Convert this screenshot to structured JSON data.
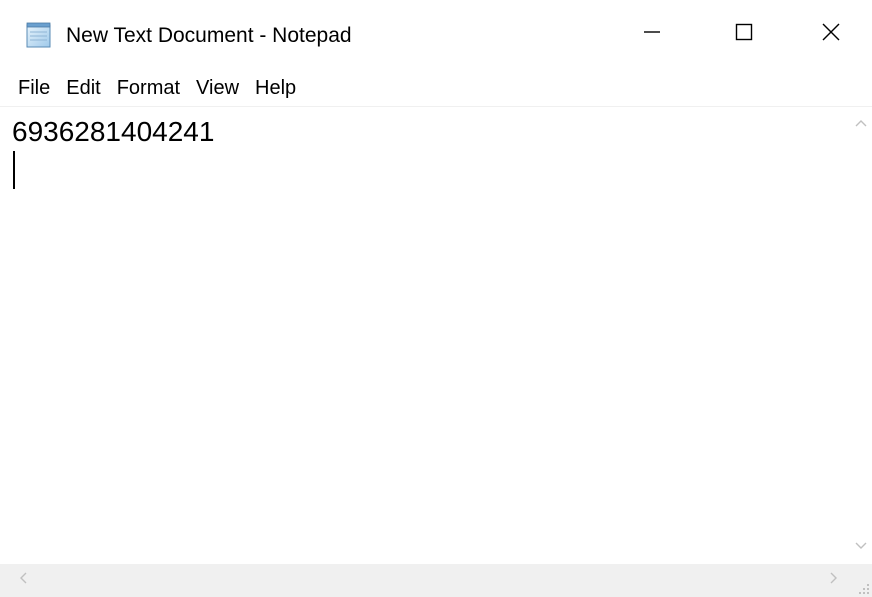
{
  "window": {
    "title": "New Text Document - Notepad"
  },
  "title_buttons": {
    "minimize_icon": "minimize-icon",
    "maximize_icon": "maximize-icon",
    "close_icon": "close-icon"
  },
  "menu": {
    "items": [
      {
        "label": "File"
      },
      {
        "label": "Edit"
      },
      {
        "label": "Format"
      },
      {
        "label": "View"
      },
      {
        "label": "Help"
      }
    ]
  },
  "editor": {
    "content": "6936281404241"
  },
  "colors": {
    "background": "#ffffff",
    "scrollbar_track": "#f0f0f0",
    "scroll_arrow": "#c0c0c0",
    "close_hover": "#e81123"
  }
}
